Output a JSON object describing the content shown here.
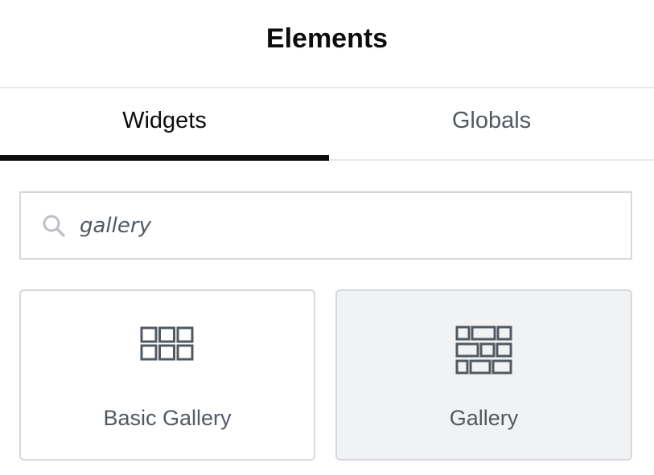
{
  "panel": {
    "title": "Elements"
  },
  "tabs": [
    {
      "label": "Widgets",
      "active": true
    },
    {
      "label": "Globals",
      "active": false
    }
  ],
  "search": {
    "value": "gallery",
    "icon": "search-icon"
  },
  "widgets": [
    {
      "label": "Basic Gallery",
      "icon": "basic-gallery-icon"
    },
    {
      "label": "Gallery",
      "icon": "gallery-icon"
    }
  ],
  "colors": {
    "text_dark": "#0c0d0e",
    "text_muted": "#515962",
    "border": "#d5d8dc",
    "hover_bg": "#f1f2f3"
  }
}
